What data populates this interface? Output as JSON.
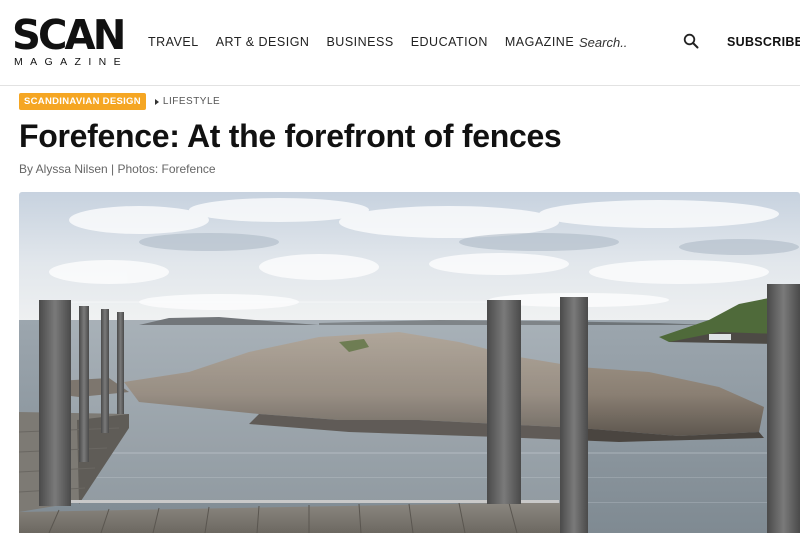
{
  "header": {
    "logo": {
      "main": "SCAN",
      "sub": "MAGAZINE"
    },
    "nav": [
      {
        "label": "TRAVEL"
      },
      {
        "label": "ART & DESIGN"
      },
      {
        "label": "BUSINESS"
      },
      {
        "label": "EDUCATION"
      },
      {
        "label": "MAGAZINE"
      }
    ],
    "search": {
      "placeholder": "Search..",
      "icon": "search-icon"
    },
    "subscribe_label": "SUBSCRIBE"
  },
  "breadcrumb": {
    "category": "SCANDINAVIAN DESIGN",
    "subcategory": "LIFESTYLE"
  },
  "article": {
    "title": "Forefence: At the forefront of fences",
    "byline": "By Alyssa Nilsen | Photos: Forefence"
  },
  "colors": {
    "accent": "#f5a623",
    "text": "#111111",
    "muted": "#666666"
  }
}
